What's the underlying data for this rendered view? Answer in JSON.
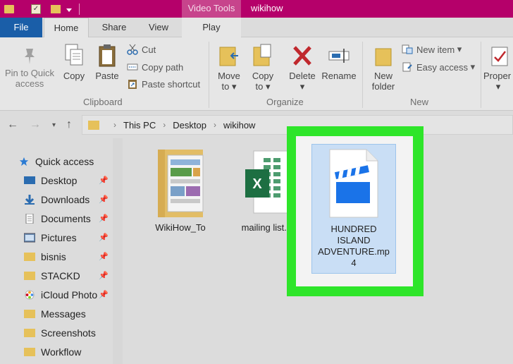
{
  "titlebar": {
    "context_tab": "Video Tools",
    "title": "wikihow"
  },
  "tabs": {
    "file": "File",
    "home": "Home",
    "share": "Share",
    "view": "View",
    "play": "Play"
  },
  "ribbon": {
    "clipboard": {
      "label": "Clipboard",
      "pin_quick_access": "Pin to Quick access",
      "pin_line1": "Pin to Quick",
      "pin_line2": "access",
      "copy": "Copy",
      "paste": "Paste",
      "cut": "Cut",
      "copy_path": "Copy path",
      "paste_shortcut": "Paste shortcut"
    },
    "organize": {
      "label": "Organize",
      "move_to_1": "Move",
      "move_to_2": "to",
      "copy_to_1": "Copy",
      "copy_to_2": "to",
      "delete": "Delete",
      "rename": "Rename"
    },
    "new": {
      "label": "New",
      "new_folder_1": "New",
      "new_folder_2": "folder",
      "new_item": "New item",
      "easy_access": "Easy access"
    },
    "open": {
      "properties": "Proper"
    }
  },
  "address": {
    "crumbs": [
      "This PC",
      "Desktop",
      "wikihow"
    ]
  },
  "sidebar": {
    "quick_access": "Quick access",
    "items": [
      {
        "label": "Desktop",
        "icon": "desktop-icon",
        "pinned": true
      },
      {
        "label": "Downloads",
        "icon": "download-icon",
        "pinned": true
      },
      {
        "label": "Documents",
        "icon": "document-icon",
        "pinned": true
      },
      {
        "label": "Pictures",
        "icon": "picture-icon",
        "pinned": true
      },
      {
        "label": "bisnis",
        "icon": "folder-icon",
        "pinned": true
      },
      {
        "label": "STACKD",
        "icon": "folder-icon",
        "pinned": true
      },
      {
        "label": "iCloud Photo",
        "icon": "icloud-photos-icon",
        "pinned": true
      },
      {
        "label": "Messages",
        "icon": "folder-icon",
        "pinned": false
      },
      {
        "label": "Screenshots",
        "icon": "folder-icon",
        "pinned": false
      },
      {
        "label": "Workflow",
        "icon": "folder-icon",
        "pinned": false
      }
    ]
  },
  "files": [
    {
      "name": "WikiHow_To",
      "icon": "folder-icon"
    },
    {
      "name": "mailing list.x",
      "icon": "excel-file-icon"
    },
    {
      "name_line1": "HUNDRED",
      "name_line2": "ISLAND",
      "name_line3": "ADVENTURE.mp",
      "name_line4": "4",
      "icon": "video-file-icon",
      "selected": true
    }
  ],
  "colors": {
    "titlebar": "#b5006a",
    "file_tab": "#1a5ea8",
    "highlight": "#2ee52a",
    "selection": "#c9def5"
  }
}
